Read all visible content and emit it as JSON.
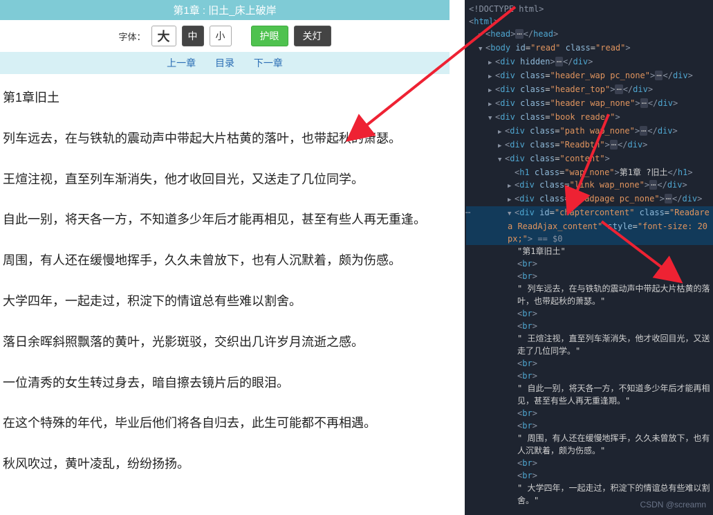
{
  "reader": {
    "title_bar": "第1章 : 旧土_床上破岸",
    "font_label": "字体：",
    "btn_big": "大",
    "btn_mid": "中",
    "btn_small": "小",
    "btn_eye": "护眼",
    "btn_light": "关灯",
    "nav_prev": "上一章",
    "nav_toc": "目录",
    "nav_next": "下一章",
    "chapter_title": "第1章旧土",
    "paragraphs": [
      "列车远去，在与铁轨的震动声中带起大片枯黄的落叶，也带起秋的萧瑟。",
      "王煊注视，直至列车渐消失，他才收回目光，又送走了几位同学。",
      "自此一别，将天各一方，不知道多少年后才能再相见，甚至有些人再无重逢。",
      "周围，有人还在缓慢地挥手，久久未曾放下，也有人沉默着，颇为伤感。",
      "大学四年，一起走过，积淀下的情谊总有些难以割舍。",
      "落日余晖斜照飘落的黄叶，光影斑驳，交织出几许岁月流逝之感。",
      "一位清秀的女生转过身去，暗自擦去镜片后的眼泪。",
      "在这个特殊的年代，毕业后他们将各自归去，此生可能都不再相遇。",
      "秋风吹过，黄叶凌乱，纷纷扬扬。"
    ]
  },
  "devtools": {
    "doctype": "<!DOCTYPE html>",
    "html_open": "html",
    "head": {
      "tag": "head",
      "ellipsis": "…"
    },
    "body": {
      "tag": "body",
      "id": "read",
      "class": "read"
    },
    "divs": [
      {
        "attr": "hidden",
        "ellipsis": true
      },
      {
        "class": "header_wap pc_none",
        "ellipsis": true
      },
      {
        "class": "header_top",
        "ellipsis": true
      },
      {
        "class": "header wap_none",
        "ellipsis": true
      }
    ],
    "book_reader": {
      "class": "book reader"
    },
    "inner_divs": [
      {
        "class": "path wap_none",
        "ellipsis": true
      },
      {
        "class": "Readbtn",
        "ellipsis": true
      }
    ],
    "content_div": {
      "class": "content"
    },
    "h1": {
      "class": "wap_none",
      "text": "第1章  ?旧土"
    },
    "link_div": {
      "class": "link wap_none",
      "ellipsis": true
    },
    "readpage_div": {
      "class": "Readpage pc_none",
      "ellipsis": true
    },
    "chapter_div": {
      "id": "chaptercontent",
      "class": "Readarea ReadAjax_content",
      "style": "font-size: 20px;",
      "eq": " == $0"
    },
    "text_nodes": [
      "\"第1章旧土\"",
      "<br>",
      "<br>",
      "\" 列车远去，在与铁轨的震动声中带起大片枯黄的落叶，也带起秋的萧瑟。\"",
      "<br>",
      "<br>",
      "\" 王煊注视，直至列车渐消失，他才收回目光，又送走了几位同学。\"",
      "<br>",
      "<br>",
      "\" 自此一别，将天各一方，不知道多少年后才能再相见，甚至有些人再无重逢期。\"",
      "<br>",
      "<br>",
      "\" 周围，有人还在缓慢地挥手，久久未曾放下，也有人沉默着，颇为伤感。\"",
      "<br>",
      "<br>",
      "\" 大学四年，一起走过，积淀下的情谊总有些难以割舍。\""
    ]
  },
  "watermark": "CSDN @screamn"
}
